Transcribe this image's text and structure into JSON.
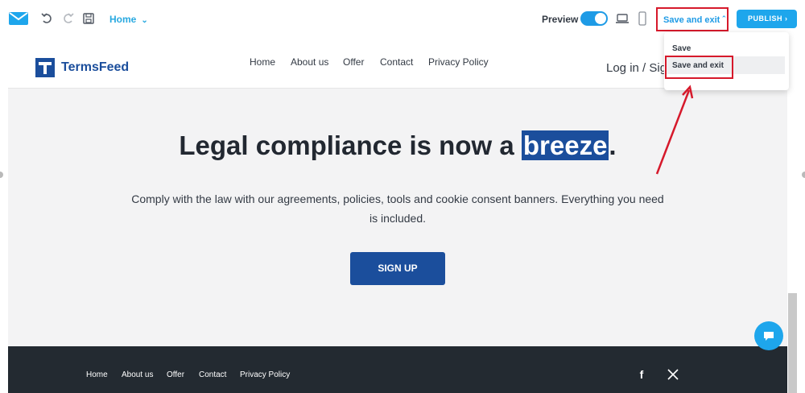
{
  "toolbar": {
    "page_select": "Home",
    "preview_label": "Preview",
    "preview_on": true,
    "save_exit_label": "Save and exit",
    "publish_label": "PUBLISH"
  },
  "save_menu": {
    "items": [
      "Save",
      "Save and exit"
    ],
    "highlighted": "Save and exit"
  },
  "site": {
    "brand": "TermsFeed",
    "nav": [
      "Home",
      "About us",
      "Offer",
      "Contact",
      "Privacy Policy"
    ],
    "login": "Log in / Sig",
    "hero_title_pre": "Legal compliance is now a ",
    "hero_title_highlight": "breeze",
    "hero_title_post": ".",
    "hero_subtitle": "Comply with the law with our agreements, policies, tools and cookie consent banners. Everything you need is included.",
    "signup_label": "SIGN UP",
    "footer_nav": [
      "Home",
      "About us",
      "Offer",
      "Contact",
      "Privacy Policy"
    ],
    "social_icons": [
      "facebook-icon",
      "x-icon"
    ]
  },
  "colors": {
    "accent": "#1ea6ec",
    "brand": "#1b4e9c",
    "annotation": "#d6192b",
    "footer": "#232a31"
  }
}
